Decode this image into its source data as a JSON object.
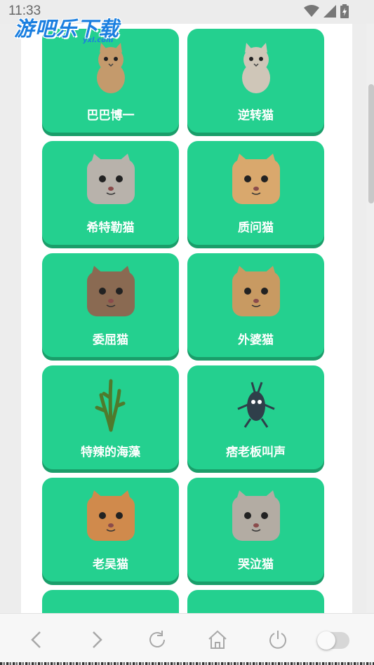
{
  "status_bar": {
    "time": "11:33",
    "icons": [
      "wifi-icon",
      "signal-icon",
      "battery-icon"
    ]
  },
  "watermark": {
    "text": "游吧乐下载",
    "sub": "yxl.com"
  },
  "cards": [
    {
      "label": "巴巴博一",
      "icon": "cat-standing-icon",
      "color": "#c49a6c"
    },
    {
      "label": "逆转猫",
      "icon": "cat-standing-icon",
      "color": "#cfc6b8"
    },
    {
      "label": "希特勒猫",
      "icon": "cat-face-icon",
      "color": "#b8b2ab"
    },
    {
      "label": "质问猫",
      "icon": "cat-face-icon",
      "color": "#d9a86d"
    },
    {
      "label": "委屈猫",
      "icon": "cat-face-icon",
      "color": "#8a6a52"
    },
    {
      "label": "外婆猫",
      "icon": "cat-face-icon",
      "color": "#c89a62"
    },
    {
      "label": "特辣的海藻",
      "icon": "seaweed-icon",
      "color": "#4f7a2c"
    },
    {
      "label": "痞老板叫声",
      "icon": "bug-icon",
      "color": "#2f3f4a"
    },
    {
      "label": "老吴猫",
      "icon": "cat-face-icon",
      "color": "#d08a4c"
    },
    {
      "label": "哭泣猫",
      "icon": "cat-face-icon",
      "color": "#b3aca3"
    }
  ],
  "bottom_nav": [
    {
      "name": "back-button",
      "icon": "chevron-left-icon"
    },
    {
      "name": "forward-button",
      "icon": "chevron-right-icon"
    },
    {
      "name": "reload-button",
      "icon": "reload-icon"
    },
    {
      "name": "home-button",
      "icon": "home-icon"
    },
    {
      "name": "power-button",
      "icon": "power-icon"
    }
  ],
  "theme": {
    "card_color": "#24d08f",
    "card_shadow": "#1a9e6a",
    "label_color": "#ffffff"
  }
}
